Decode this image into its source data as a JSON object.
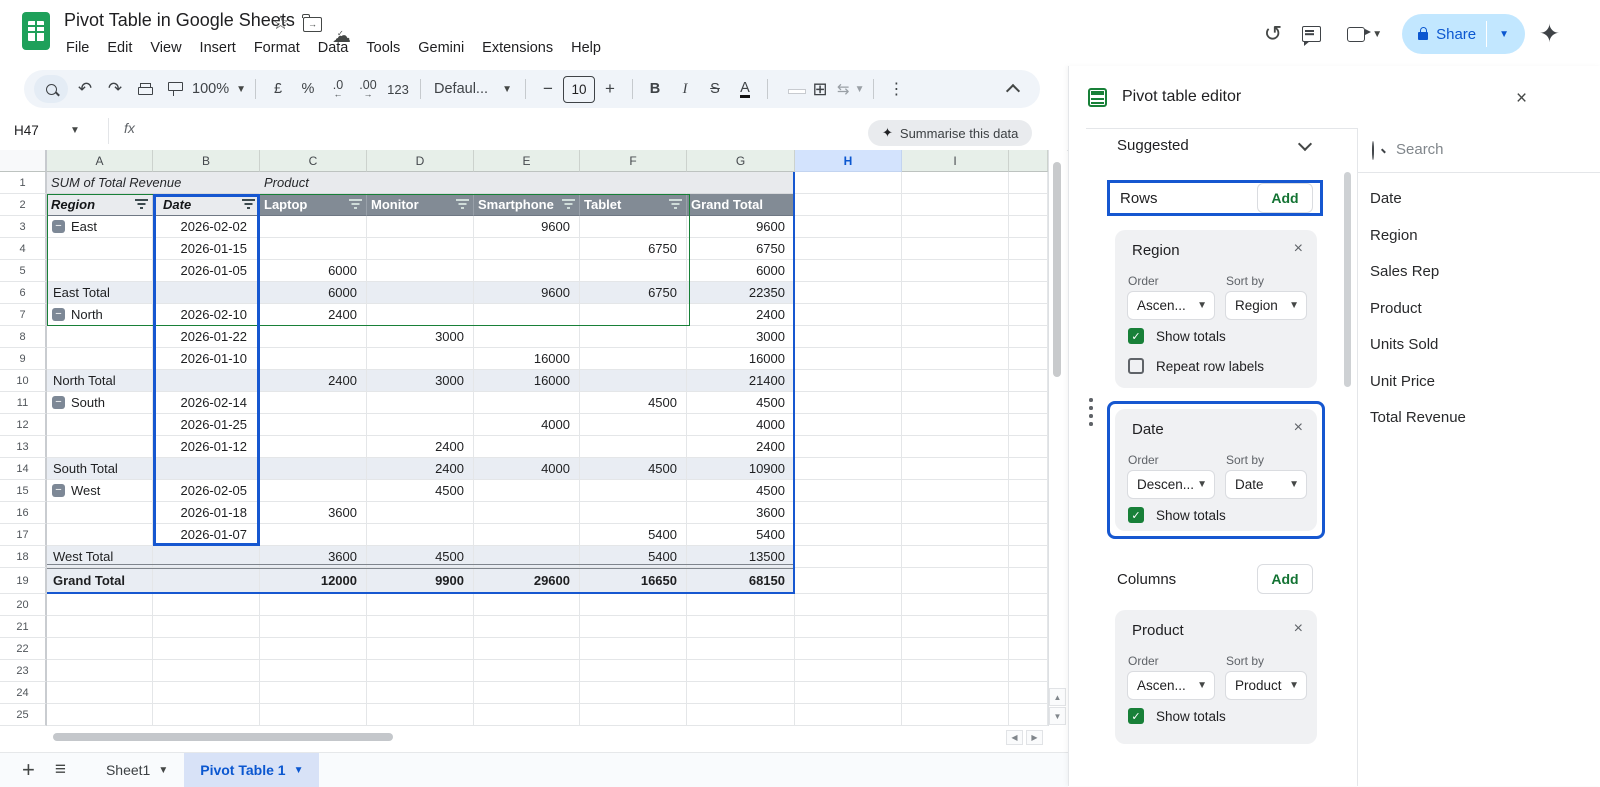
{
  "titlebar": {
    "doc_title": "Pivot Table in Google Sheets",
    "menu": [
      "File",
      "Edit",
      "View",
      "Insert",
      "Format",
      "Data",
      "Tools",
      "Gemini",
      "Extensions",
      "Help"
    ],
    "share_label": "Share"
  },
  "toolbar": {
    "zoom": "100%",
    "currency": "£",
    "percent": "%",
    "dec_decrease": ".0",
    "dec_increase": ".00",
    "plain_format": "123",
    "font": "Defaul...",
    "font_size": "10",
    "bold": "B",
    "italic": "I",
    "strike": "S",
    "text_color": "A",
    "more": "⋮"
  },
  "formula_bar": {
    "cell_ref": "H47",
    "fx": "fx",
    "summarise": "Summarise this data"
  },
  "grid": {
    "col_letters": [
      "A",
      "B",
      "C",
      "D",
      "E",
      "F",
      "G",
      "H",
      "I"
    ],
    "selected_col": "H",
    "row_count": 25,
    "pivot": {
      "a1": "SUM of Total Revenue",
      "c1": "Product",
      "header": {
        "region": "Region",
        "date": "Date",
        "products": [
          "Laptop",
          "Monitor",
          "Smartphone",
          "Tablet"
        ],
        "grand": "Grand Total"
      },
      "rows": [
        {
          "kind": "item",
          "label": "East",
          "collapse": true,
          "date": "2026-02-02",
          "vals": [
            "",
            "",
            "9600",
            "",
            "9600"
          ]
        },
        {
          "kind": "item",
          "label": "",
          "collapse": false,
          "date": "2026-01-15",
          "vals": [
            "",
            "",
            "",
            "6750",
            "6750"
          ]
        },
        {
          "kind": "item",
          "label": "",
          "collapse": false,
          "date": "2026-01-05",
          "vals": [
            "6000",
            "",
            "",
            "",
            "6000"
          ]
        },
        {
          "kind": "total",
          "label": "East Total",
          "collapse": false,
          "date": "",
          "vals": [
            "6000",
            "",
            "9600",
            "6750",
            "22350"
          ]
        },
        {
          "kind": "item",
          "label": "North",
          "collapse": true,
          "date": "2026-02-10",
          "vals": [
            "2400",
            "",
            "",
            "",
            "2400"
          ]
        },
        {
          "kind": "item",
          "label": "",
          "collapse": false,
          "date": "2026-01-22",
          "vals": [
            "",
            "3000",
            "",
            "",
            "3000"
          ]
        },
        {
          "kind": "item",
          "label": "",
          "collapse": false,
          "date": "2026-01-10",
          "vals": [
            "",
            "",
            "16000",
            "",
            "16000"
          ]
        },
        {
          "kind": "total",
          "label": "North Total",
          "collapse": false,
          "date": "",
          "vals": [
            "2400",
            "3000",
            "16000",
            "",
            "21400"
          ]
        },
        {
          "kind": "item",
          "label": "South",
          "collapse": true,
          "date": "2026-02-14",
          "vals": [
            "",
            "",
            "",
            "4500",
            "4500"
          ]
        },
        {
          "kind": "item",
          "label": "",
          "collapse": false,
          "date": "2026-01-25",
          "vals": [
            "",
            "",
            "4000",
            "",
            "4000"
          ]
        },
        {
          "kind": "item",
          "label": "",
          "collapse": false,
          "date": "2026-01-12",
          "vals": [
            "",
            "2400",
            "",
            "",
            "2400"
          ]
        },
        {
          "kind": "total",
          "label": "South Total",
          "collapse": false,
          "date": "",
          "vals": [
            "",
            "2400",
            "4000",
            "4500",
            "10900"
          ]
        },
        {
          "kind": "item",
          "label": "West",
          "collapse": true,
          "date": "2026-02-05",
          "vals": [
            "",
            "4500",
            "",
            "",
            "4500"
          ]
        },
        {
          "kind": "item",
          "label": "",
          "collapse": false,
          "date": "2026-01-18",
          "vals": [
            "3600",
            "",
            "",
            "",
            "3600"
          ]
        },
        {
          "kind": "item",
          "label": "",
          "collapse": false,
          "date": "2026-01-07",
          "vals": [
            "",
            "",
            "",
            "5400",
            "5400"
          ]
        },
        {
          "kind": "total",
          "label": "West Total",
          "collapse": false,
          "date": "",
          "vals": [
            "3600",
            "4500",
            "",
            "5400",
            "13500"
          ]
        },
        {
          "kind": "grand",
          "label": "Grand Total",
          "collapse": false,
          "date": "",
          "vals": [
            "12000",
            "9900",
            "29600",
            "16650",
            "68150"
          ]
        }
      ]
    }
  },
  "panel": {
    "title": "Pivot table editor",
    "suggested_label": "Suggested",
    "search_placeholder": "Search",
    "order_label": "Order",
    "sortby_label": "Sort by",
    "totals_label": "Show totals",
    "repeat_label": "Repeat row labels",
    "rows_section": {
      "label": "Rows",
      "add_label": "Add"
    },
    "columns_section": {
      "label": "Columns",
      "add_label": "Add"
    },
    "cards": [
      {
        "title": "Region",
        "order": "Ascen...",
        "sort_by": "Region",
        "show_totals": true,
        "has_repeat": true,
        "repeat_checked": false,
        "highlighted": false
      },
      {
        "title": "Date",
        "order": "Descen...",
        "sort_by": "Date",
        "show_totals": true,
        "has_repeat": false,
        "repeat_checked": false,
        "highlighted": true
      },
      {
        "title": "Product",
        "order": "Ascen...",
        "sort_by": "Product",
        "show_totals": true,
        "has_repeat": false,
        "repeat_checked": false,
        "highlighted": false
      }
    ],
    "fields": [
      "Date",
      "Region",
      "Sales Rep",
      "Product",
      "Units Sold",
      "Unit Price",
      "Total Revenue"
    ]
  },
  "sheet_bar": {
    "tabs": [
      {
        "name": "Sheet1",
        "active": false
      },
      {
        "name": "Pivot Table 1",
        "active": true
      }
    ]
  },
  "colors": {
    "selection_blue": "#1657d0",
    "range_green": "#188038",
    "header_grey": "#828b95",
    "total_row": "#e9edf3",
    "selected_col_header": "#d3e3fd",
    "share_pill": "#c2e7ff"
  }
}
